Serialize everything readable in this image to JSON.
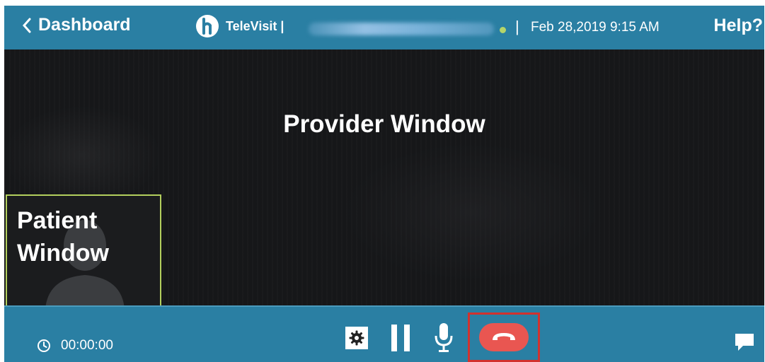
{
  "header": {
    "back_label": "Dashboard",
    "brand_name": "TeleVisit |",
    "separator": "|",
    "datetime": "Feb 28,2019 9:15 AM",
    "help_label": "Help?"
  },
  "video": {
    "provider_label": "Provider Window",
    "patient_label_line1": "Patient",
    "patient_label_line2": "Window"
  },
  "controls": {
    "timer": "00:00:00",
    "icons": {
      "timer": "clock-icon",
      "settings": "gear-icon",
      "pause": "pause-icon",
      "mic": "microphone-icon",
      "end_call": "phone-hangup-icon",
      "chat": "chat-bubble-icon"
    }
  },
  "colors": {
    "bar": "#2a7fa3",
    "video_bg": "#161719",
    "patient_border": "#b3cf5d",
    "status_dot": "#b5d56a",
    "end_call": "#e95651",
    "end_call_highlight": "#d2322e"
  }
}
